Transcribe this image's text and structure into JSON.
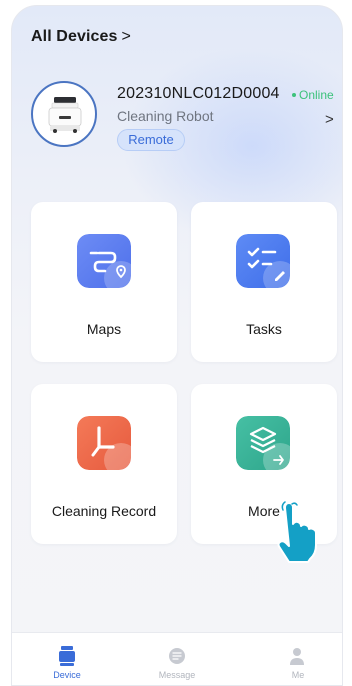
{
  "header": {
    "title": "All Devices",
    "chevron": ">"
  },
  "device": {
    "serial": "202310NLC012D0004",
    "status": "Online",
    "model": "Cleaning Robot",
    "remote_label": "Remote",
    "chevron": ">"
  },
  "cards": {
    "maps": {
      "label": "Maps",
      "icon": "map-icon"
    },
    "tasks": {
      "label": "Tasks",
      "icon": "task-list-icon"
    },
    "cleaning_record": {
      "label": "Cleaning Record",
      "icon": "clock-icon"
    },
    "more": {
      "label": "More",
      "icon": "layers-icon"
    }
  },
  "tabs": [
    {
      "label": "Device",
      "icon": "device-icon",
      "active": true
    },
    {
      "label": "Message",
      "icon": "message-icon",
      "active": false
    },
    {
      "label": "Me",
      "icon": "person-icon",
      "active": false
    }
  ],
  "colors": {
    "accent": "#3a6cd8",
    "online": "#3cc27b",
    "maps_icon": "#5b7ff0",
    "tasks_icon": "#4f7cf0",
    "record_icon": "#ef6a4c",
    "more_icon": "#3cb39a",
    "pointer": "#14a0c6"
  }
}
